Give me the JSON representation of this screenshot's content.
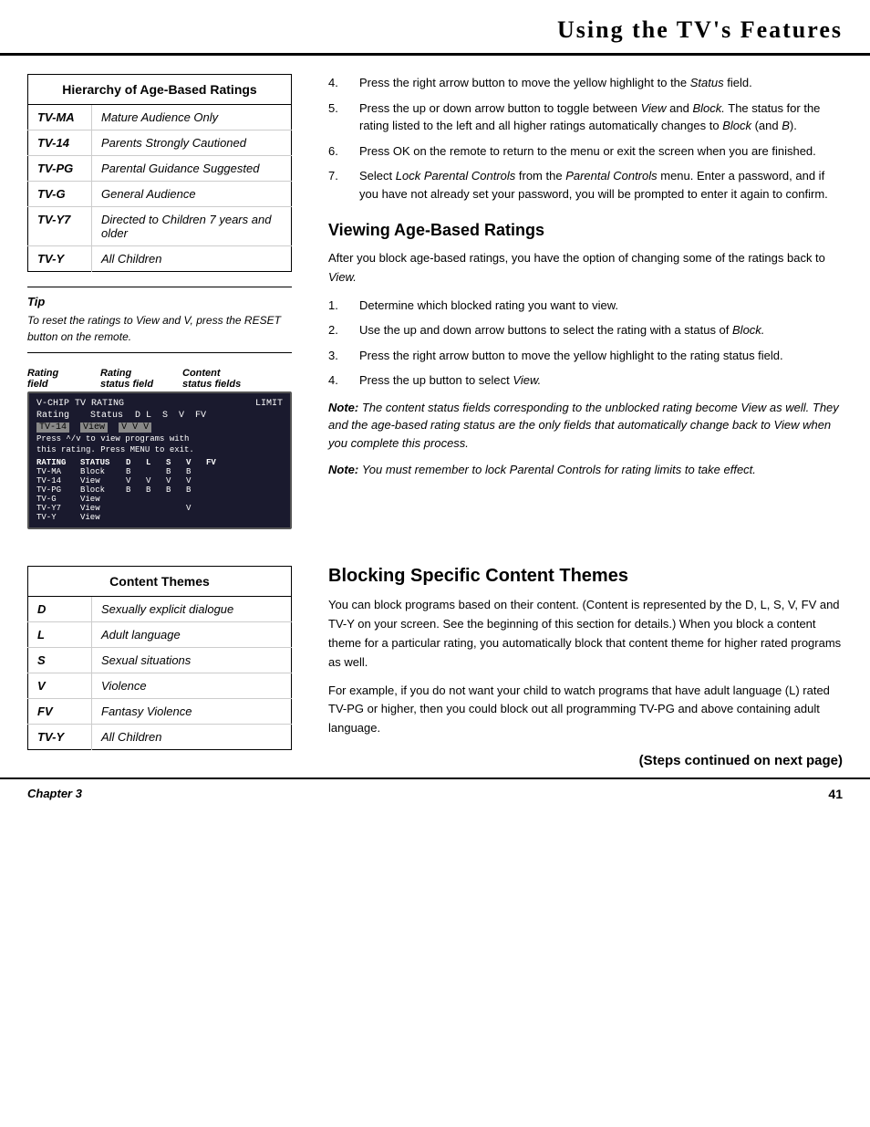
{
  "header": {
    "title": "Using the TV's Features"
  },
  "hierarchy_table": {
    "heading": "Hierarchy of Age-Based Ratings",
    "rows": [
      {
        "code": "TV-MA",
        "description": "Mature Audience Only"
      },
      {
        "code": "TV-14",
        "description": "Parents Strongly Cautioned"
      },
      {
        "code": "TV-PG",
        "description": "Parental Guidance Suggested"
      },
      {
        "code": "TV-G",
        "description": "General Audience"
      },
      {
        "code": "TV-Y7",
        "description": "Directed to Children 7 years and older"
      },
      {
        "code": "TV-Y",
        "description": "All Children"
      }
    ]
  },
  "tip": {
    "label": "Tip",
    "text": "To reset the ratings to View and V, press the RESET button on the remote."
  },
  "chip_diagram": {
    "label_field": "Rating\nfield",
    "label_status": "Rating\nstatus field",
    "label_content": "Content\nstatus fields"
  },
  "viewing_section": {
    "title": "Viewing Age-Based Ratings",
    "intro": "After you block age-based ratings, you have the option of changing some of the ratings back to  View.",
    "steps": [
      "Determine which blocked rating you want to view.",
      "Use the up and down arrow buttons to select the rating with a status  of Block.",
      "Press the right arrow button to move the yellow highlight to the rating status field.",
      "Press the up button to select View."
    ],
    "note1_label": "Note:",
    "note1_text": "The content status fields corresponding to the unblocked rating become View as well. They and the age-based rating status are the only fields that automatically change back to View when you complete this process.",
    "note2_label": "Note:",
    "note2_text": "You must remember to lock Parental Controls for rating limits to take effect."
  },
  "steps_4_to_7": {
    "step4": "Press the right arrow button to move the yellow highlight to the Status field.",
    "step5_part1": "Press the up or down arrow button to toggle between",
    "step5_view": "View",
    "step5_and": "and",
    "step5_block": "Block.",
    "step5_part2": "The status for the rating listed to the left and all higher ratings automatically changes to",
    "step5_block2": "Block",
    "step5_paren": "(and B).",
    "step6": "Press OK on the remote to return to the menu or exit the screen when you are finished.",
    "step7_part1": "Select",
    "step7_lock": "Lock Parental Controls",
    "step7_from": "from the",
    "step7_menu": "Parental Controls",
    "step7_part2": "menu. Enter a password, and if you have not already set your password, you will be prompted to enter it again to confirm."
  },
  "blocking_section": {
    "title": "Blocking Specific Content Themes",
    "para1": "You can block programs based on their content. (Content is represented by the D, L, S, V, FV and TV-Y on your screen. See the beginning of this section for details.) When you block a content theme for a particular rating, you automatically block that content theme for higher rated programs as well.",
    "para2": "For example, if you do not want your child to watch programs that have adult language (L) rated TV-PG or higher, then you could block out all programming TV-PG and above containing adult language.",
    "steps_continued": "(Steps continued on next page)"
  },
  "content_table": {
    "heading": "Content Themes",
    "rows": [
      {
        "code": "D",
        "description": "Sexually explicit dialogue"
      },
      {
        "code": "L",
        "description": "Adult language"
      },
      {
        "code": "S",
        "description": "Sexual situations"
      },
      {
        "code": "V",
        "description": "Violence"
      },
      {
        "code": "FV",
        "description": "Fantasy Violence"
      },
      {
        "code": "TV-Y",
        "description": "All Children"
      }
    ]
  },
  "footer": {
    "chapter": "Chapter 3",
    "page": "41"
  }
}
